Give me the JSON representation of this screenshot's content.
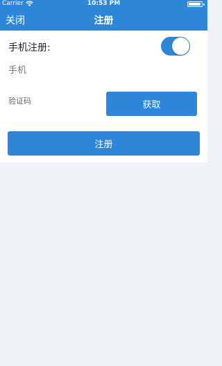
{
  "status_bar": {
    "carrier": "Carrier",
    "time": "10:53 PM",
    "battery_level": 0.95,
    "wifi_icon": "wifi-icon",
    "battery_icon": "battery-icon"
  },
  "nav": {
    "close_label": "关闭",
    "title": "注册"
  },
  "form": {
    "phone_register_label": "手机注册:",
    "phone_register_toggle_on": true,
    "phone_placeholder": "手机",
    "code_placeholder": "验证码",
    "get_code_label": "获取",
    "register_label": "注册"
  },
  "colors": {
    "accent": "#2d86d8",
    "background": "#eff2f6",
    "surface": "#ffffff"
  }
}
